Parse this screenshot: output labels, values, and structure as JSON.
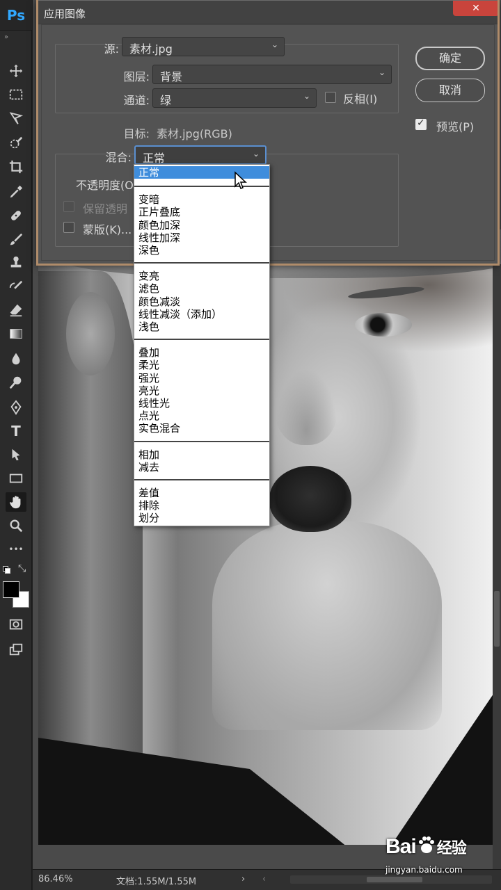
{
  "app": {
    "logo": "Ps"
  },
  "toolbar": {
    "collapse": "»",
    "tools": [
      {
        "name": "move-tool"
      },
      {
        "name": "marquee-tool"
      },
      {
        "name": "lasso-tool"
      },
      {
        "name": "quick-select-tool"
      },
      {
        "name": "crop-tool"
      },
      {
        "name": "eyedropper-tool"
      },
      {
        "name": "healing-brush-tool"
      },
      {
        "name": "brush-tool"
      },
      {
        "name": "clone-stamp-tool"
      },
      {
        "name": "history-brush-tool"
      },
      {
        "name": "eraser-tool"
      },
      {
        "name": "gradient-tool"
      },
      {
        "name": "blur-tool"
      },
      {
        "name": "dodge-tool"
      },
      {
        "name": "pen-tool"
      },
      {
        "name": "type-tool"
      },
      {
        "name": "path-selection-tool"
      },
      {
        "name": "rectangle-tool"
      },
      {
        "name": "hand-tool",
        "active": true
      },
      {
        "name": "zoom-tool"
      },
      {
        "name": "more-tools"
      }
    ],
    "type_glyph": "T",
    "more_glyph": "•••",
    "foreground_color": "#000000",
    "background_color": "#ffffff"
  },
  "dialog": {
    "title": "应用图像",
    "source": {
      "label": "源:",
      "value": "素材.jpg"
    },
    "layer": {
      "label": "图层:",
      "value": "背景"
    },
    "channel": {
      "label": "通道:",
      "value": "绿"
    },
    "invert": {
      "label": "反相(I)",
      "checked": false
    },
    "target": {
      "label": "目标:",
      "value": "素材.jpg(RGB)"
    },
    "blending": {
      "label": "混合:",
      "value": "正常"
    },
    "opacity": {
      "label": "不透明度(O"
    },
    "preserve_transparency": {
      "label": "保留透明",
      "checked": false,
      "disabled": true
    },
    "mask": {
      "label": "蒙版(K)...",
      "checked": false
    },
    "ok_label": "确定",
    "cancel_label": "取消",
    "preview": {
      "label": "预览(P)",
      "checked": true
    },
    "close_glyph": "✕"
  },
  "blend_modes": {
    "groups": [
      [
        "正常"
      ],
      [
        "变暗",
        "正片叠底",
        "颜色加深",
        "线性加深",
        "深色"
      ],
      [
        "变亮",
        "滤色",
        "颜色减淡",
        "线性减淡（添加）",
        "浅色"
      ],
      [
        "叠加",
        "柔光",
        "强光",
        "亮光",
        "线性光",
        "点光",
        "实色混合"
      ],
      [
        "相加",
        "减去"
      ],
      [
        "差值",
        "排除",
        "划分"
      ]
    ],
    "selected": "正常",
    "highlight_color": "#3f8ddc"
  },
  "status": {
    "zoom": "86.46%",
    "doc": "文档:1.55M/1.55M",
    "arrow": "›",
    "scroll_left": "‹"
  },
  "watermark": {
    "logo_left": "Bai",
    "logo_right": "经验",
    "url": "jingyan.baidu.com"
  },
  "colors": {
    "panel": "#535353",
    "accent_blue": "#3f8ddc",
    "close_red": "#c9443c"
  }
}
